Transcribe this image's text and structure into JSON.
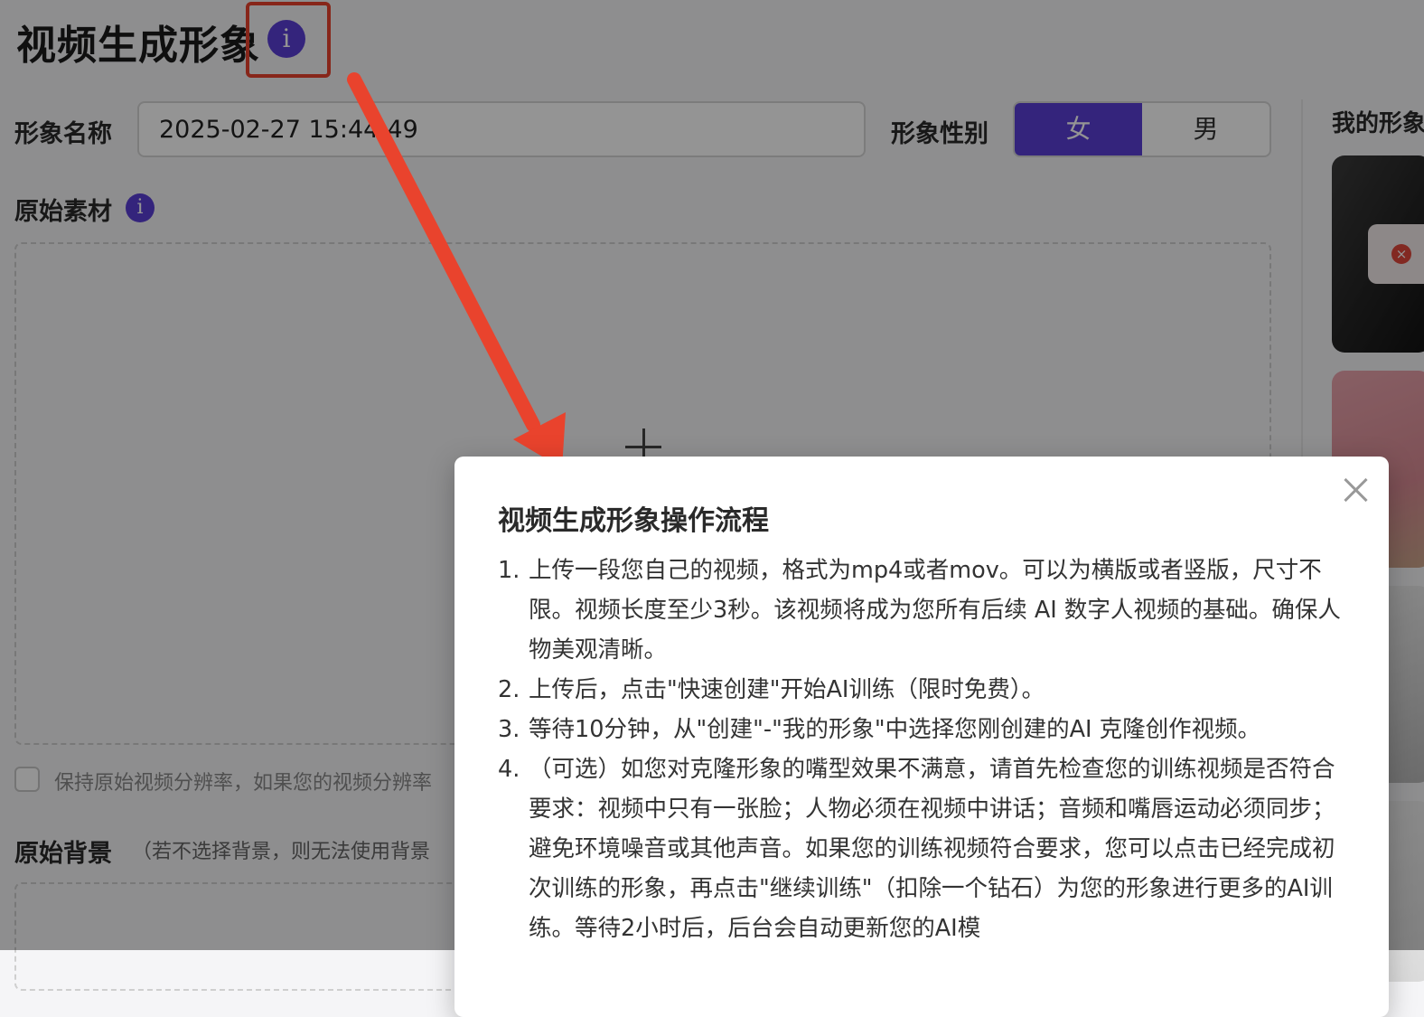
{
  "page": {
    "title": "视频生成形象",
    "name_label": "形象名称",
    "name_value": "2025-02-27 15:44:49",
    "gender_label": "形象性别",
    "gender_female": "女",
    "gender_male": "男",
    "source_label": "原始素材",
    "keep_resolution_hint": "保持原始视频分辨率，如果您的视频分辨率",
    "background_label": "原始背景",
    "background_hint": "（若不选择背景，则无法使用背景",
    "side_title": "我的形象"
  },
  "icons": {
    "info": "i",
    "delete": "×"
  },
  "colors": {
    "accent": "#5b3fd6",
    "highlight": "#e9432d"
  },
  "modal": {
    "title": "视频生成形象操作流程",
    "steps": [
      {
        "num": "1.",
        "text": "上传一段您自己的视频，格式为mp4或者mov。可以为横版或者竖版，尺寸不限。视频长度至少3秒。该视频将成为您所有后续 AI 数字人视频的基础。确保人物美观清晰。"
      },
      {
        "num": "2.",
        "text": "上传后，点击\"快速创建\"开始AI训练（限时免费）。"
      },
      {
        "num": "3.",
        "text": "等待10分钟，从\"创建\"-\"我的形象\"中选择您刚创建的AI 克隆创作视频。"
      },
      {
        "num": "4.",
        "text": "（可选）如您对克隆形象的嘴型效果不满意，请首先检查您的训练视频是否符合要求：视频中只有一张脸；人物必须在视频中讲话；音频和嘴唇运动必须同步；避免环境噪音或其他声音。如果您的训练视频符合要求，您可以点击已经完成初次训练的形象，再点击\"继续训练\"（扣除一个钻石）为您的形象进行更多的AI训练。等待2小时后，后台会自动更新您的AI模"
      }
    ]
  }
}
